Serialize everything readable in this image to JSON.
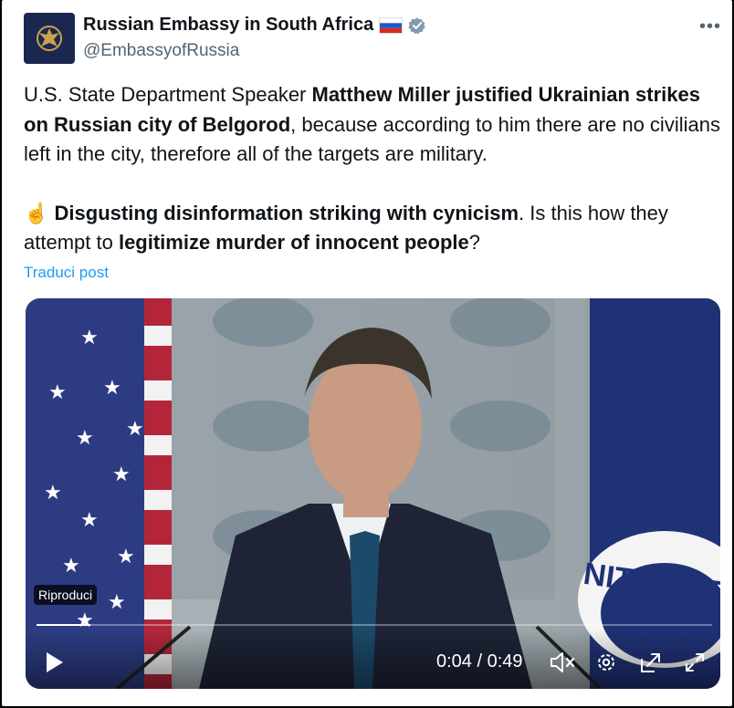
{
  "account": {
    "display_name": "Russian Embassy in South Africa",
    "handle": "@EmbassyofRussia",
    "flag": "russia-flag",
    "verified_color": "#829aab"
  },
  "more_label": "•••",
  "tweet": {
    "p1": [
      "U.S. State Department Speaker ",
      "Matthew Miller justified Ukrainian strikes on Russian city of Belgorod",
      ", because according to him there are no civilians left in the city, therefore all of the targets are military."
    ],
    "p2": [
      "☝️",
      "Disgusting disinformation striking with cynicism",
      ". Is this how they attempt to ",
      "legitimize murder of innocent people",
      "?"
    ]
  },
  "translate_link": "Traduci post",
  "video": {
    "play_badge": "Riproduci",
    "current_time": "0:04",
    "separator": " / ",
    "duration": "0:49",
    "progress": 0.08,
    "podium_text": "NITED STA",
    "icons": [
      "play-icon",
      "mute-icon",
      "settings-icon",
      "popout-icon",
      "fullscreen-icon"
    ]
  },
  "colors": {
    "link": "#1d9bf0",
    "text": "#0f1419",
    "secondary": "#536471"
  }
}
